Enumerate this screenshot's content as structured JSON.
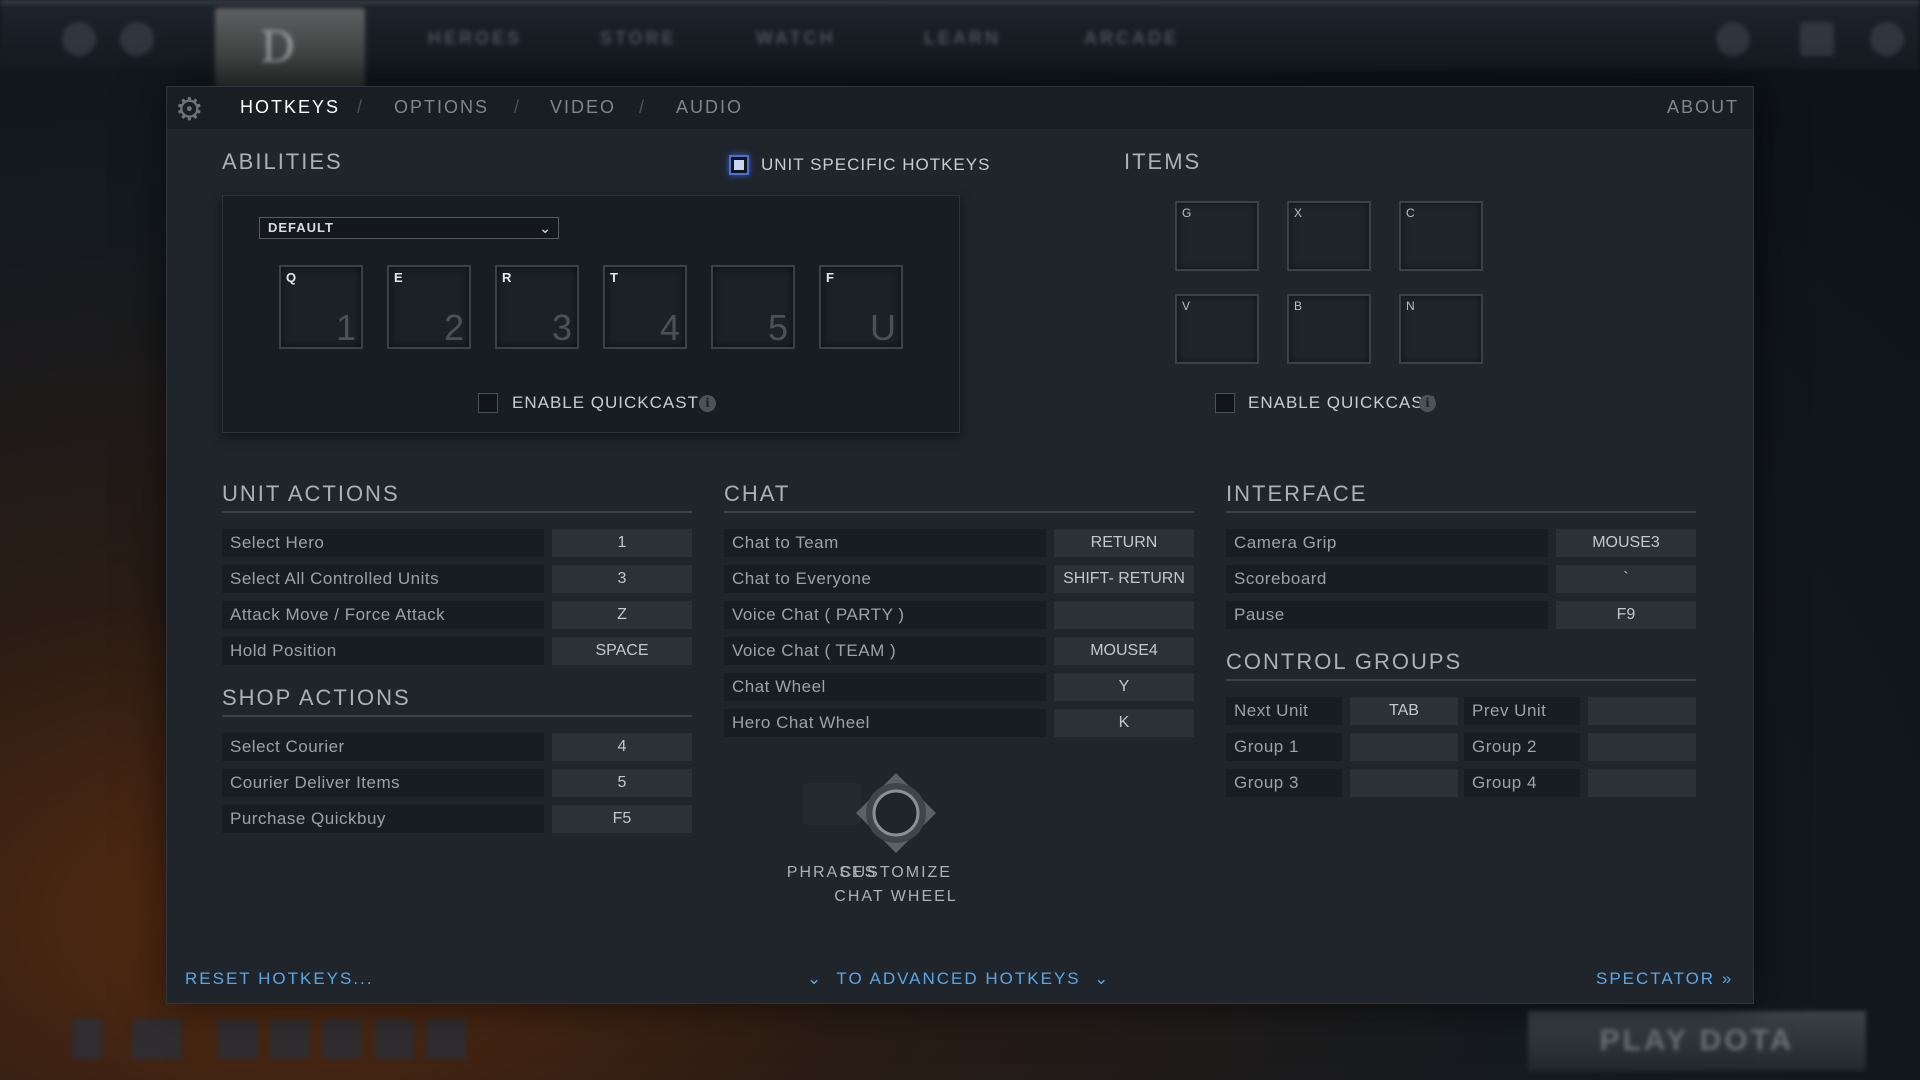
{
  "topbar": {
    "nav": [
      "HEROES",
      "STORE",
      "WATCH",
      "LEARN",
      "ARCADE"
    ]
  },
  "bottombar": {
    "play_label": "PLAY DOTA"
  },
  "tabs": {
    "hotkeys": "HOTKEYS",
    "options": "OPTIONS",
    "video": "VIDEO",
    "audio": "AUDIO",
    "separator": "/",
    "about": "ABOUT"
  },
  "abilities": {
    "title": "ABILITIES",
    "unit_specific_label": "UNIT SPECIFIC HOTKEYS",
    "dropdown_value": "DEFAULT",
    "slots": [
      {
        "key": "Q",
        "num": "1"
      },
      {
        "key": "E",
        "num": "2"
      },
      {
        "key": "R",
        "num": "3"
      },
      {
        "key": "T",
        "num": "4"
      },
      {
        "key": "",
        "num": "5"
      },
      {
        "key": "F",
        "num": "U"
      }
    ],
    "quickcast_label": "ENABLE QUICKCAST"
  },
  "items": {
    "title": "ITEMS",
    "slots": [
      "G",
      "X",
      "C",
      "V",
      "B",
      "N"
    ],
    "quickcast_label": "ENABLE QUICKCAST"
  },
  "unit_actions": {
    "title": "UNIT ACTIONS",
    "rows": [
      {
        "label": "Select Hero",
        "key": "1"
      },
      {
        "label": "Select All Controlled Units",
        "key": "3"
      },
      {
        "label": "Attack Move / Force Attack",
        "key": "Z"
      },
      {
        "label": "Hold Position",
        "key": "SPACE"
      }
    ]
  },
  "shop_actions": {
    "title": "SHOP ACTIONS",
    "rows": [
      {
        "label": "Select Courier",
        "key": "4"
      },
      {
        "label": "Courier Deliver Items",
        "key": "5"
      },
      {
        "label": "Purchase Quickbuy",
        "key": "F5"
      }
    ]
  },
  "chat": {
    "title": "CHAT",
    "rows": [
      {
        "label": "Chat to Team",
        "key": "RETURN"
      },
      {
        "label": "Chat to Everyone",
        "key": "SHIFT- RETURN"
      },
      {
        "label": "Voice Chat ( PARTY )",
        "key": ""
      },
      {
        "label": "Voice Chat ( TEAM )",
        "key": "MOUSE4"
      },
      {
        "label": "Chat Wheel",
        "key": "Y"
      },
      {
        "label": "Hero Chat Wheel",
        "key": "K"
      }
    ],
    "phrases_label": "PHRASES",
    "customize_line1": "CUSTOMIZE",
    "customize_line2": "CHAT WHEEL"
  },
  "interface": {
    "title": "INTERFACE",
    "rows": [
      {
        "label": "Camera Grip",
        "key": "MOUSE3"
      },
      {
        "label": "Scoreboard",
        "key": "`"
      },
      {
        "label": "Pause",
        "key": "F9"
      }
    ]
  },
  "control_groups": {
    "title": "CONTROL GROUPS",
    "rows": [
      [
        {
          "label": "Next Unit",
          "key": "TAB"
        },
        {
          "label": "Prev Unit",
          "key": ""
        }
      ],
      [
        {
          "label": "Group 1",
          "key": ""
        },
        {
          "label": "Group 2",
          "key": ""
        }
      ],
      [
        {
          "label": "Group 3",
          "key": ""
        },
        {
          "label": "Group 4",
          "key": ""
        }
      ]
    ]
  },
  "footer": {
    "reset": "RESET HOTKEYS...",
    "advanced": "TO ADVANCED HOTKEYS",
    "spectator": "SPECTATOR"
  },
  "colors": {
    "accent_link": "#5aa6e6",
    "panel_bg": "#1f252b",
    "checkbox_highlight": "#4d6fd6"
  }
}
